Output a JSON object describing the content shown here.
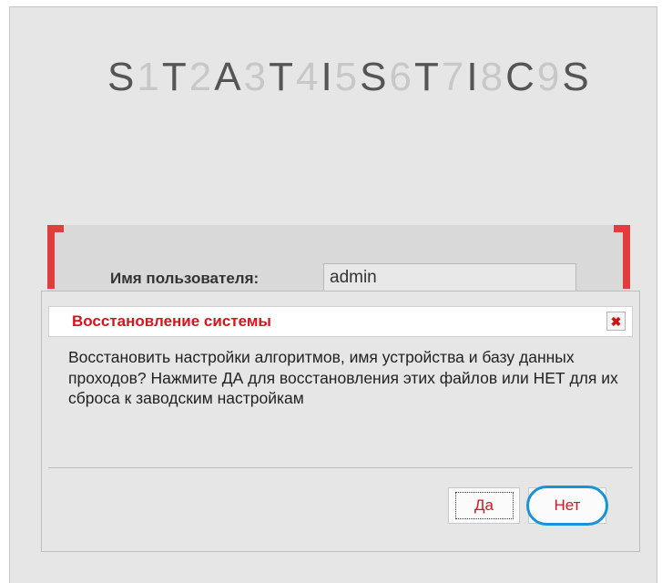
{
  "logo": {
    "chars": [
      {
        "ch": "S",
        "light": false
      },
      {
        "ch": "1",
        "light": true
      },
      {
        "ch": "T",
        "light": false
      },
      {
        "ch": "2",
        "light": true
      },
      {
        "ch": "A",
        "light": false
      },
      {
        "ch": "3",
        "light": true
      },
      {
        "ch": "T",
        "light": false
      },
      {
        "ch": "4",
        "light": true
      },
      {
        "ch": "I",
        "light": false
      },
      {
        "ch": "5",
        "light": true
      },
      {
        "ch": "S",
        "light": false
      },
      {
        "ch": "6",
        "light": true
      },
      {
        "ch": "T",
        "light": false
      },
      {
        "ch": "7",
        "light": true
      },
      {
        "ch": "I",
        "light": false
      },
      {
        "ch": "8",
        "light": true
      },
      {
        "ch": "C",
        "light": false
      },
      {
        "ch": "9",
        "light": true
      },
      {
        "ch": "S",
        "light": false
      }
    ]
  },
  "login": {
    "username_label": "Имя пользователя:",
    "username_value": "admin"
  },
  "dialog": {
    "title": "Восстановление системы",
    "close_icon": "close-icon",
    "message": "Восстановить настройки алгоритмов, имя устройства и базу данных проходов? Нажмите ДА для восстановления этих файлов или НЕТ для их сброса к заводским настройкам",
    "yes_label": "Да",
    "no_label": "Нет"
  },
  "colors": {
    "accent_red": "#d7141e",
    "bracket_red": "#e03d3d",
    "highlight_blue": "#1a93d6",
    "window_bg": "#e6e6e6"
  }
}
